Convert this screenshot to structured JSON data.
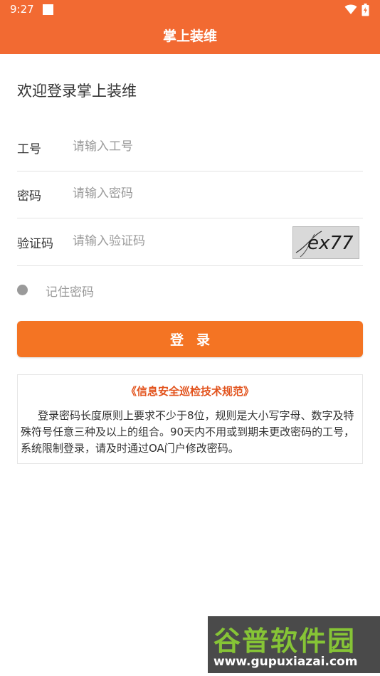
{
  "status_bar": {
    "time": "9:27"
  },
  "app": {
    "title": "掌上装维",
    "accent_color": "#f26a32"
  },
  "welcome": "欢迎登录掌上装维",
  "form": {
    "employee_id": {
      "label": "工号",
      "placeholder": "请输入工号",
      "value": ""
    },
    "password": {
      "label": "密码",
      "placeholder": "请输入密码",
      "value": ""
    },
    "captcha": {
      "label": "验证码",
      "placeholder": "请输入验证码",
      "value": "",
      "image_text": "ex77"
    }
  },
  "remember": {
    "label": "记住密码",
    "checked": false
  },
  "login_button": {
    "label": "登录"
  },
  "notice": {
    "title": "《信息安全巡检技术规范》",
    "body": "登录密码长度原则上要求不少于8位，规则是大小写字母、数字及特殊符号任意三种及以上的组合。90天内不用或到期未更改密码的工号，系统限制登录，请及时通过OA门户修改密码。"
  },
  "watermark": {
    "line1": "谷普软件园",
    "line2": "www.gupuxiazai.com"
  }
}
